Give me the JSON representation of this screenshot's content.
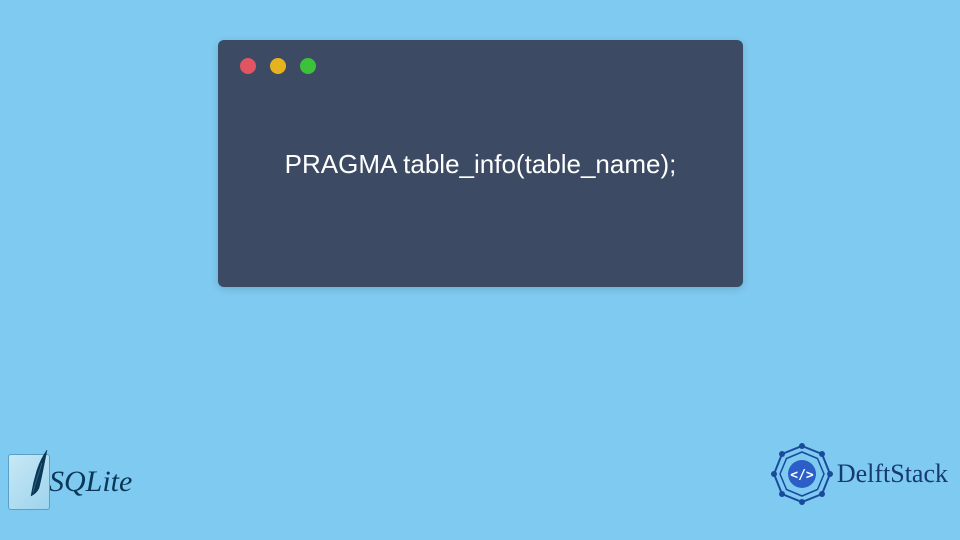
{
  "code_window": {
    "content": "PRAGMA table_info(table_name);"
  },
  "logos": {
    "sqlite_text": "SQLite",
    "delftstack_text": "DelftStack"
  },
  "colors": {
    "background": "#7fcaf0",
    "window_bg": "#3c4a63",
    "dot_red": "#e05561",
    "dot_yellow": "#e6b31e",
    "dot_green": "#3cc13b"
  }
}
